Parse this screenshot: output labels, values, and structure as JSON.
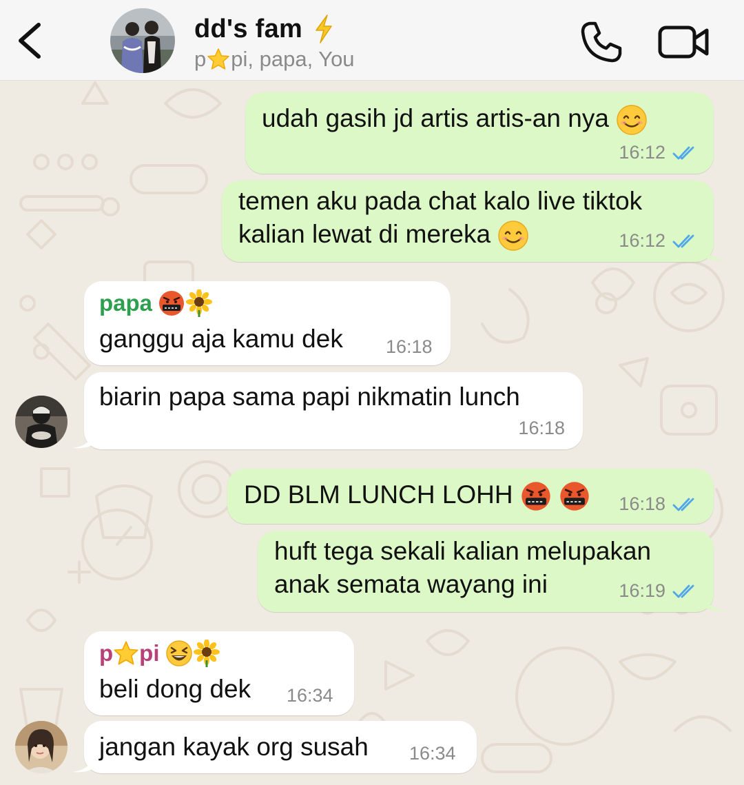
{
  "header": {
    "group_name": "dd's fam",
    "members_prefix": "p",
    "members_suffix": "pi, papa, You"
  },
  "colors": {
    "outgoing_bubble": "#dcf8c6",
    "incoming_bubble": "#ffffff",
    "read_ticks": "#4fa6e8",
    "sender_papa": "#2e9e4f",
    "sender_papi": "#b8417a",
    "background": "#efeae2"
  },
  "messages": [
    {
      "lines": [
        "udah gasih jd artis artis-an nya"
      ],
      "time": "16:12"
    },
    {
      "lines": [
        "temen aku pada chat kalo live tiktok",
        "kalian lewat di mereka"
      ],
      "time": "16:12"
    },
    {
      "sender": "papa",
      "lines": [
        "ganggu aja kamu dek"
      ],
      "time": "16:18"
    },
    {
      "lines": [
        "biarin papa sama papi nikmatin lunch"
      ],
      "time": "16:18"
    },
    {
      "lines": [
        "DD BLM LUNCH LOHH"
      ],
      "time": "16:18"
    },
    {
      "lines": [
        "huft tega sekali kalian melupakan",
        "anak semata wayang ini"
      ],
      "time": "16:19"
    },
    {
      "sender_prefix": "p",
      "sender_suffix": "pi",
      "lines": [
        "beli dong dek"
      ],
      "time": "16:34"
    },
    {
      "lines": [
        "jangan kayak org susah"
      ],
      "time": "16:34"
    }
  ],
  "icons": {
    "back": "chevron-left-icon",
    "call": "phone-icon",
    "video": "video-camera-icon",
    "read": "double-check-icon",
    "bolt": "lightning-icon",
    "star": "star-icon"
  }
}
